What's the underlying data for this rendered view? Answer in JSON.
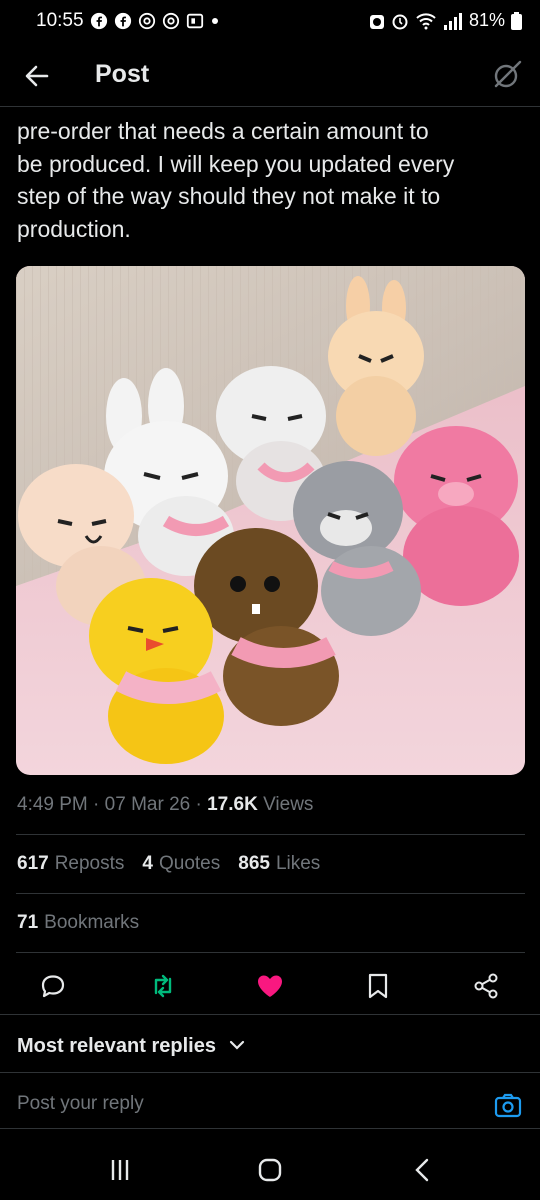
{
  "status_bar": {
    "time": "10:55",
    "battery": "81%",
    "icons": [
      "facebook-icon",
      "facebook-icon",
      "threads-icon",
      "threads-icon",
      "flipboard-icon",
      "dot-icon",
      "alarm-icon",
      "wifi-icon",
      "signal-icon",
      "battery-icon"
    ]
  },
  "header": {
    "title": "Post"
  },
  "post": {
    "text_line1": "pre-order that needs a certain amount to",
    "text_line2": "be produced. I will keep you updated every",
    "text_line3": "step of the way should they not make it to",
    "text_line4": "production.",
    "image_description_icon": "plush-toys-photo",
    "time": "4:49 PM",
    "date": "07 Mar 26",
    "views_count": "17.6K",
    "views_label": "Views"
  },
  "stats": {
    "reposts_count": "617",
    "reposts_label": "Reposts",
    "quotes_count": "4",
    "quotes_label": "Quotes",
    "likes_count": "865",
    "likes_label": "Likes",
    "bookmarks_count": "71",
    "bookmarks_label": "Bookmarks"
  },
  "actions": [
    "reply-icon",
    "repost-icon",
    "like-icon",
    "bookmark-icon",
    "share-icon"
  ],
  "colors": {
    "repost_active": "#00ba7c",
    "like_active": "#f91880",
    "link_blue": "#1d9bf0"
  },
  "replies": {
    "filter_label": "Most relevant replies",
    "input_placeholder": "Post your reply"
  }
}
